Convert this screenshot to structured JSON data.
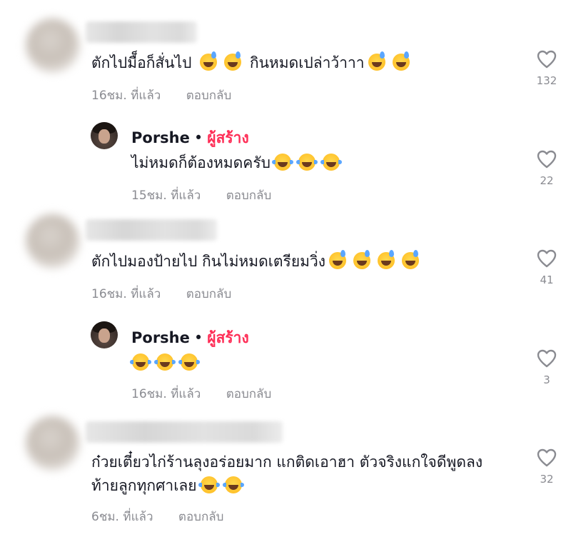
{
  "comments": [
    {
      "text": "ตักไปมื็อก็สั่นไป",
      "text2": "กินหมดเปล่าว้าาา",
      "time": "16ชม. ที่แล้ว",
      "reply": "ตอบกลับ",
      "likes": "132"
    },
    {
      "author": "Porshe",
      "dot": "•",
      "badge": "ผู้สร้าง",
      "text": "ไม่หมดก็ต้องหมดครับ",
      "time": "15ชม. ที่แล้ว",
      "reply": "ตอบกลับ",
      "likes": "22"
    },
    {
      "text": "ตักไปมองป้ายไป กินไม่หมดเตรียมวิ่ง",
      "time": "16ชม. ที่แล้ว",
      "reply": "ตอบกลับ",
      "likes": "41"
    },
    {
      "author": "Porshe",
      "dot": "•",
      "badge": "ผู้สร้าง",
      "time": "16ชม. ที่แล้ว",
      "reply": "ตอบกลับ",
      "likes": "3"
    },
    {
      "text": "ก๋วยเตี๋ยวไก่ร้านลุงอร่อยมาก แกติดเอาฮา ตัวจริงแกใจดีพูดลง",
      "text2": "ท้ายลูกทุกศาเลย",
      "time": "6ชม. ที่แล้ว",
      "reply": "ตอบกลับ",
      "likes": "32"
    }
  ],
  "icons": {
    "like": "heart-outline-icon",
    "sweat": "sweat-smile-emoji-icon",
    "laugh": "tears-of-joy-emoji-icon"
  },
  "colors": {
    "creator_badge": "#fe2c55",
    "meta": "#8a8b91"
  }
}
